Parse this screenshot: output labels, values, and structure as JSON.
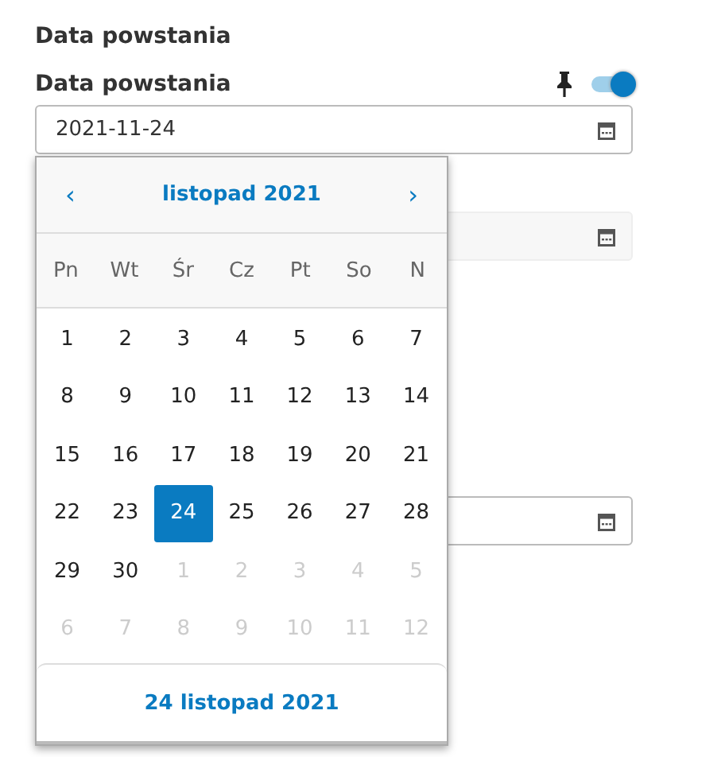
{
  "section_title": "Data powstania",
  "field": {
    "label": "Data powstania",
    "value": "2021-11-24",
    "pinned": true,
    "toggle_on": true
  },
  "calendar": {
    "prev": "‹",
    "month": "listopad 2021",
    "next": "›",
    "weekdays": [
      "Pn",
      "Wt",
      "Śr",
      "Cz",
      "Pt",
      "So",
      "N"
    ],
    "days": [
      {
        "label": "1",
        "kind": "current",
        "selected": false
      },
      {
        "label": "2",
        "kind": "current",
        "selected": false
      },
      {
        "label": "3",
        "kind": "current",
        "selected": false
      },
      {
        "label": "4",
        "kind": "current",
        "selected": false
      },
      {
        "label": "5",
        "kind": "current",
        "selected": false
      },
      {
        "label": "6",
        "kind": "current",
        "selected": false
      },
      {
        "label": "7",
        "kind": "current",
        "selected": false
      },
      {
        "label": "8",
        "kind": "current",
        "selected": false
      },
      {
        "label": "9",
        "kind": "current",
        "selected": false
      },
      {
        "label": "10",
        "kind": "current",
        "selected": false
      },
      {
        "label": "11",
        "kind": "current",
        "selected": false
      },
      {
        "label": "12",
        "kind": "current",
        "selected": false
      },
      {
        "label": "13",
        "kind": "current",
        "selected": false
      },
      {
        "label": "14",
        "kind": "current",
        "selected": false
      },
      {
        "label": "15",
        "kind": "current",
        "selected": false
      },
      {
        "label": "16",
        "kind": "current",
        "selected": false
      },
      {
        "label": "17",
        "kind": "current",
        "selected": false
      },
      {
        "label": "18",
        "kind": "current",
        "selected": false
      },
      {
        "label": "19",
        "kind": "current",
        "selected": false
      },
      {
        "label": "20",
        "kind": "current",
        "selected": false
      },
      {
        "label": "21",
        "kind": "current",
        "selected": false
      },
      {
        "label": "22",
        "kind": "current",
        "selected": false
      },
      {
        "label": "23",
        "kind": "current",
        "selected": false
      },
      {
        "label": "24",
        "kind": "current",
        "selected": true
      },
      {
        "label": "25",
        "kind": "current",
        "selected": false
      },
      {
        "label": "26",
        "kind": "current",
        "selected": false
      },
      {
        "label": "27",
        "kind": "current",
        "selected": false
      },
      {
        "label": "28",
        "kind": "current",
        "selected": false
      },
      {
        "label": "29",
        "kind": "current",
        "selected": false
      },
      {
        "label": "30",
        "kind": "current",
        "selected": false
      },
      {
        "label": "1",
        "kind": "other",
        "selected": false
      },
      {
        "label": "2",
        "kind": "other",
        "selected": false
      },
      {
        "label": "3",
        "kind": "other",
        "selected": false
      },
      {
        "label": "4",
        "kind": "other",
        "selected": false
      },
      {
        "label": "5",
        "kind": "other",
        "selected": false
      },
      {
        "label": "6",
        "kind": "other",
        "selected": false
      },
      {
        "label": "7",
        "kind": "other",
        "selected": false
      },
      {
        "label": "8",
        "kind": "other",
        "selected": false
      },
      {
        "label": "9",
        "kind": "other",
        "selected": false
      },
      {
        "label": "10",
        "kind": "other",
        "selected": false
      },
      {
        "label": "11",
        "kind": "other",
        "selected": false
      },
      {
        "label": "12",
        "kind": "other",
        "selected": false
      }
    ],
    "footer": "24 listopad 2021"
  },
  "other_fields": [
    {
      "kind": "disabled"
    },
    {
      "kind": "normal"
    }
  ]
}
